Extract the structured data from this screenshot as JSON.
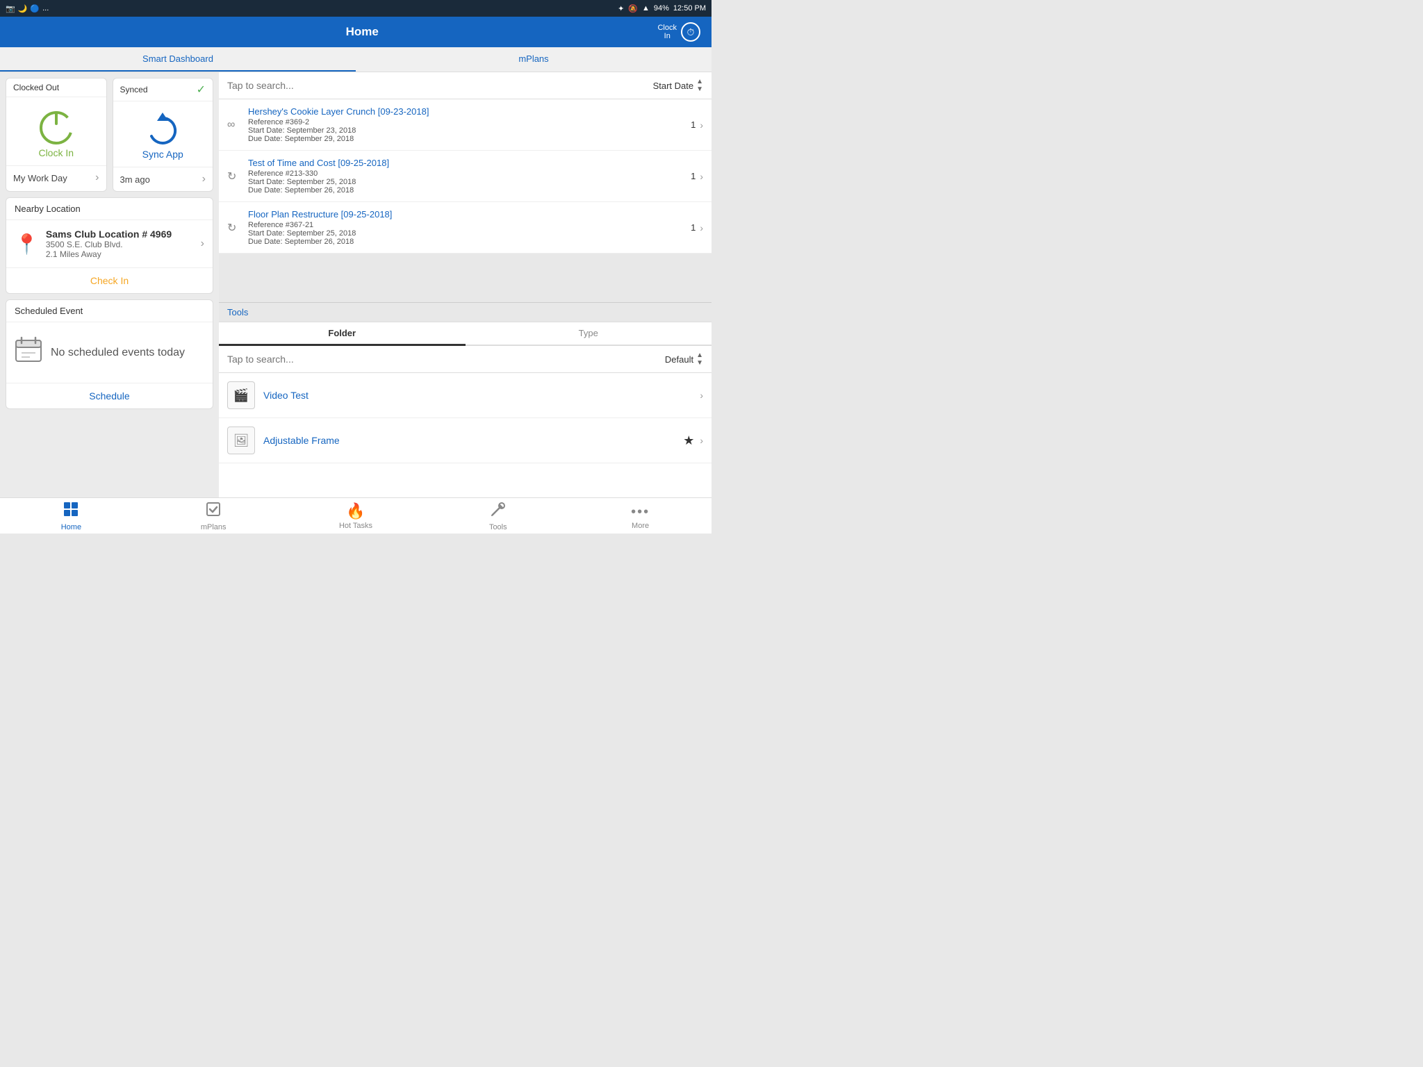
{
  "statusBar": {
    "leftIcons": [
      "📷",
      "🌙",
      "🔵",
      "..."
    ],
    "battery": "94%",
    "time": "12:50 PM",
    "bluetooth": "BT",
    "mute": "🔕",
    "wifi": "WiFi"
  },
  "topNav": {
    "title": "Home",
    "clockInLabel": "Clock\nIn"
  },
  "tabs": {
    "smartDashboard": "Smart Dashboard",
    "mPlans": "mPlans"
  },
  "clockCard": {
    "header": "Clocked Out",
    "label": "Clock In",
    "footer": "My Work Day"
  },
  "syncCard": {
    "header": "Synced",
    "label": "Sync App",
    "footer": "3m ago"
  },
  "nearbyLocation": {
    "header": "Nearby Location",
    "name": "Sams Club Location # 4969",
    "address": "3500 S.E. Club Blvd.",
    "distance": "2.1 Miles Away",
    "checkIn": "Check In"
  },
  "scheduledEvent": {
    "header": "Scheduled Event",
    "noEvents": "No scheduled events today",
    "scheduleBtn": "Schedule"
  },
  "mPlansSearch": {
    "placeholder": "Tap to search...",
    "sortLabel": "Start Date"
  },
  "mPlansItems": [
    {
      "title": "Hershey's Cookie Layer Crunch [09-23-2018]",
      "ref": "Reference #369-2",
      "startDate": "Start Date: September 23, 2018",
      "dueDate": "Due Date: September 29, 2018",
      "count": "1",
      "icon": "∞"
    },
    {
      "title": "Test of Time and Cost [09-25-2018]",
      "ref": "Reference #213-330",
      "startDate": "Start Date: September 25, 2018",
      "dueDate": "Due Date: September 26, 2018",
      "count": "1",
      "icon": "↻"
    },
    {
      "title": "Floor Plan Restructure [09-25-2018]",
      "ref": "Reference #367-21",
      "startDate": "Start Date: September 25, 2018",
      "dueDate": "Due Date: September 26, 2018",
      "count": "1",
      "icon": "↻"
    }
  ],
  "tools": {
    "header": "Tools",
    "tabs": [
      "Folder",
      "Type"
    ],
    "searchPlaceholder": "Tap to search...",
    "sortLabel": "Default",
    "items": [
      {
        "name": "Video Test",
        "icon": "🎬",
        "star": false
      },
      {
        "name": "Adjustable Frame",
        "icon": "🖼",
        "star": true
      }
    ]
  },
  "bottomNav": [
    {
      "label": "Home",
      "icon": "⊞",
      "active": true
    },
    {
      "label": "mPlans",
      "icon": "☑",
      "active": false
    },
    {
      "label": "Hot Tasks",
      "icon": "🔥",
      "active": false
    },
    {
      "label": "Tools",
      "icon": "🔧",
      "active": false
    },
    {
      "label": "More",
      "icon": "•••",
      "active": false
    }
  ]
}
